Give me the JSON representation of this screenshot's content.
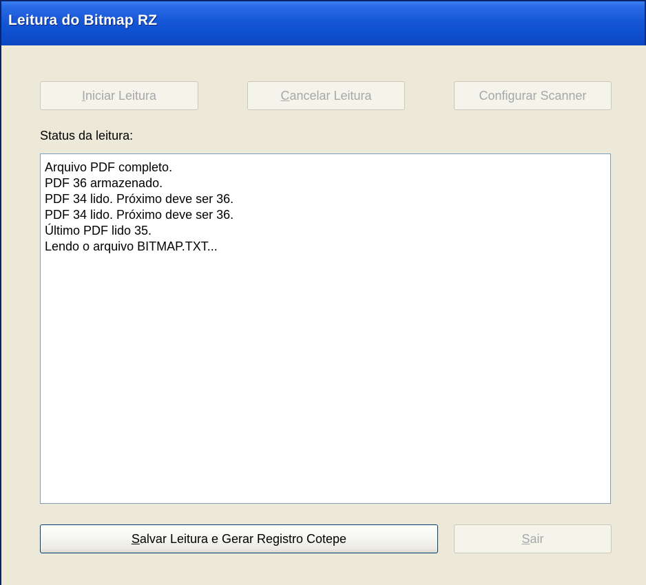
{
  "window": {
    "title": "Leitura do Bitmap RZ"
  },
  "toolbar": {
    "start_reading": {
      "label_first": "I",
      "label_rest": "niciar Leitura",
      "enabled": false
    },
    "cancel_reading": {
      "label_first": "C",
      "label_rest": "ancelar Leitura",
      "enabled": false
    },
    "configure_scanner": {
      "label": "Configurar Scanner",
      "enabled": false
    }
  },
  "status": {
    "label": "Status da leitura:",
    "lines": [
      "Arquivo PDF completo.",
      "PDF 36 armazenado.",
      "PDF 34 lido. Próximo deve ser 36.",
      "PDF 34 lido. Próximo deve ser 36.",
      "Último PDF lido 35.",
      "Lendo o arquivo BITMAP.TXT..."
    ]
  },
  "footer": {
    "save_and_generate": {
      "label_first": "S",
      "label_rest": "alvar Leitura e Gerar Registro Cotepe",
      "enabled": true
    },
    "exit": {
      "label_first": "S",
      "label_rest": "air",
      "enabled": false
    }
  },
  "colors": {
    "titlebar": "#0e4fcf",
    "dialog_bg": "#ece9d8",
    "disabled_text": "#a7a6aa",
    "listbox_border": "#7f9db9"
  }
}
